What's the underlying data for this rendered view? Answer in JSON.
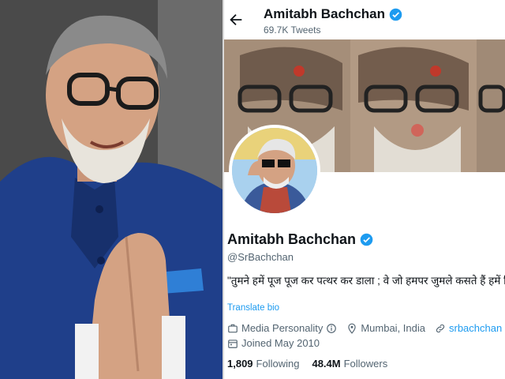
{
  "header": {
    "name": "Amitabh Bachchan",
    "tweet_count": "69.7K Tweets"
  },
  "profile": {
    "name": "Amitabh Bachchan",
    "handle": "@SrBachchan",
    "bio": "\"तुमने हमें पूज पूज कर पत्थर कर डाला ; वे जो हमपर जुमले कसते हैं हमें ज़िन्दा तो समझते हैं\"~ हरिवंश राय बच्चन",
    "translate_label": "Translate bio",
    "category": "Media Personality",
    "location": "Mumbai, India",
    "website": "srbachchan",
    "joined": "Joined May 2010",
    "following_count": "1,809",
    "following_label": "Following",
    "followers_count": "48.4M",
    "followers_label": "Followers"
  },
  "icons": {
    "back": "back-arrow-icon",
    "verified": "verified-badge-icon",
    "category": "briefcase-icon",
    "info": "info-icon",
    "location": "location-pin-icon",
    "link": "link-icon",
    "calendar": "calendar-icon"
  },
  "colors": {
    "accent": "#1d9bf0",
    "text": "#0f1419",
    "secondary": "#536471"
  }
}
